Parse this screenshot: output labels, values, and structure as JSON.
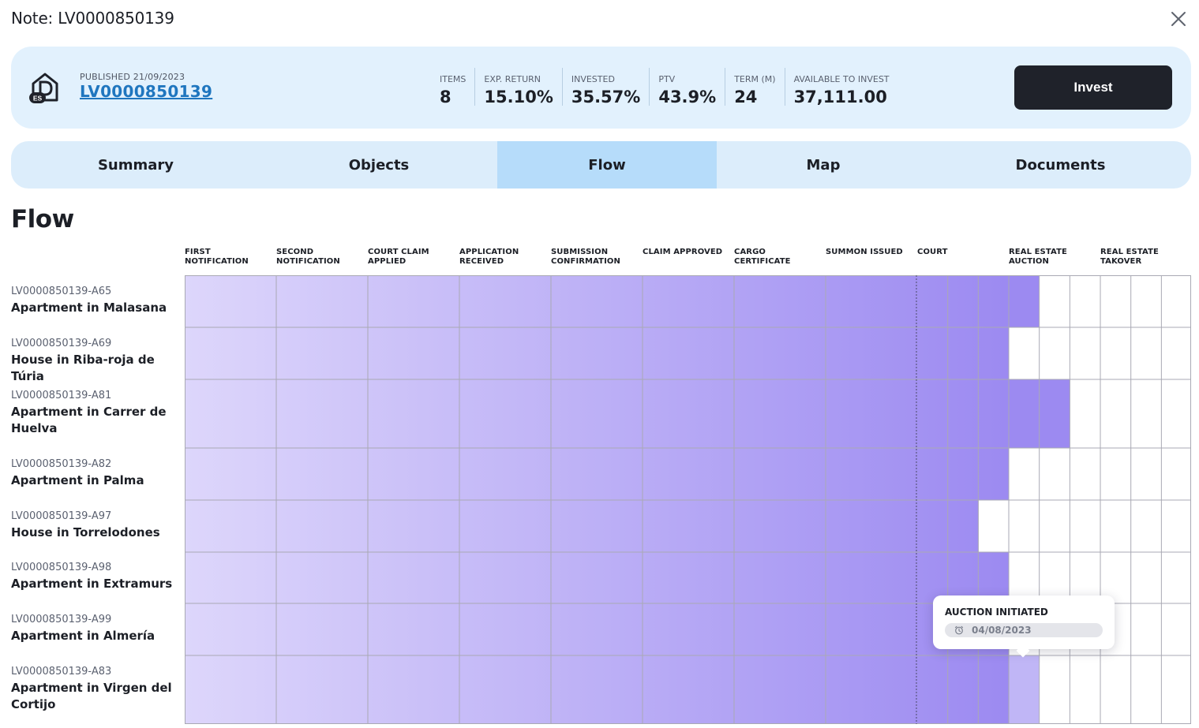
{
  "modal": {
    "title": "Note: LV0000850139"
  },
  "header": {
    "published": "PUBLISHED 21/09/2023",
    "note_id": "LV0000850139",
    "logo_badge": "ES",
    "stats": [
      {
        "label": "ITEMS",
        "value": "8"
      },
      {
        "label": "EXP. RETURN",
        "value": "15.10%"
      },
      {
        "label": "INVESTED",
        "value": "35.57%"
      },
      {
        "label": "PTV",
        "value": "43.9%"
      },
      {
        "label": "TERM (M)",
        "value": "24"
      },
      {
        "label": "AVAILABLE TO INVEST",
        "value": "37,111.00"
      }
    ],
    "invest_label": "Invest"
  },
  "tabs": [
    {
      "label": "Summary",
      "active": false
    },
    {
      "label": "Objects",
      "active": false
    },
    {
      "label": "Flow",
      "active": true
    },
    {
      "label": "Map",
      "active": false
    },
    {
      "label": "Documents",
      "active": false
    }
  ],
  "flow": {
    "title": "Flow",
    "stages": [
      "FIRST NOTIFICATION",
      "SECOND NOTIFICATION",
      "COURT CLAIM APPLIED",
      "APPLICATION RECEIVED",
      "SUBMISSION CONFIRMATION",
      "CLAIM APPROVED",
      "CARGO CERTIFICATE",
      "SUMMON ISSUED",
      "COURT",
      "REAL ESTATE AUCTION",
      "REAL ESTATE TAKOVER"
    ],
    "rows": [
      {
        "code": "LV0000850139-A65",
        "name": "Apartment in Malasana",
        "progress": 9.33
      },
      {
        "code": "LV0000850139-A69",
        "name": "House in Riba-roja de Túria",
        "progress": 9.0
      },
      {
        "code": "LV0000850139-A81",
        "name": "Apartment in Carrer de Huelva",
        "progress": 9.67
      },
      {
        "code": "LV0000850139-A82",
        "name": "Apartment in Palma",
        "progress": 9.0
      },
      {
        "code": "LV0000850139-A97",
        "name": "House in Torrelodones",
        "progress": 8.67
      },
      {
        "code": "LV0000850139-A98",
        "name": "Apartment in Extramurs",
        "progress": 9.0
      },
      {
        "code": "LV0000850139-A99",
        "name": "Apartment in Almería",
        "progress": 9.0
      },
      {
        "code": "LV0000850139-A83",
        "name": "Apartment in Virgen del Cortijo",
        "progress": 9.33,
        "highlight_segment": true
      }
    ],
    "tooltip": {
      "title": "AUCTION INITIATED",
      "date": "04/08/2023"
    }
  }
}
